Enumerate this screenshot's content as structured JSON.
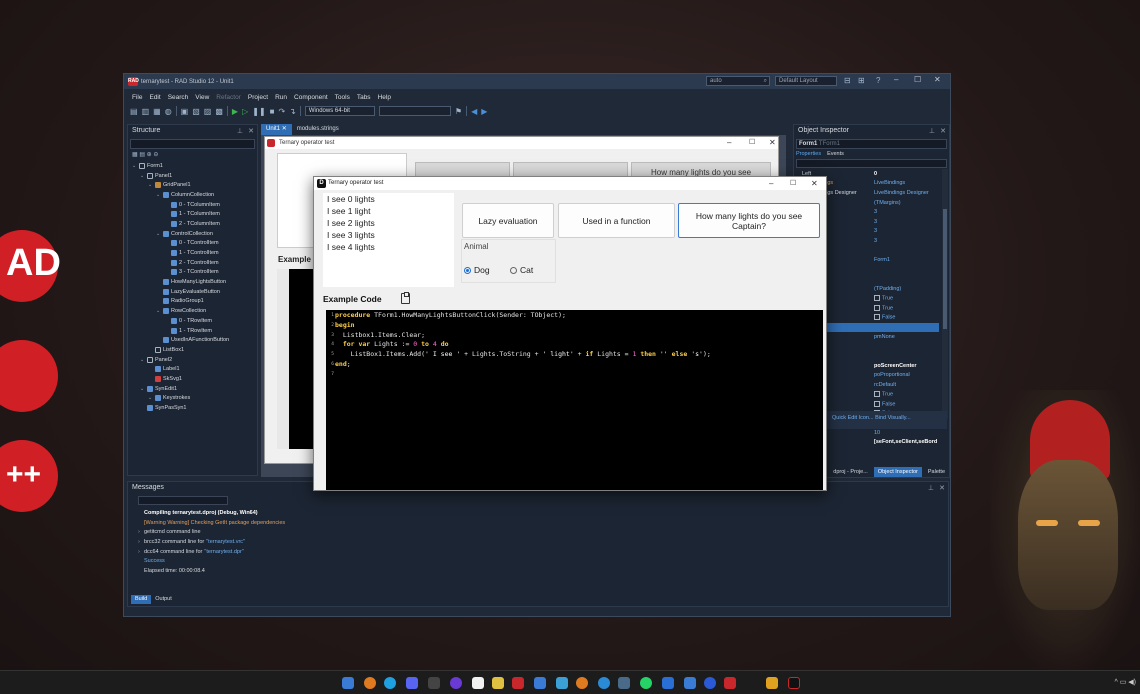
{
  "ide": {
    "title": "ternarytest - RAD Studio 12 - Unit1",
    "search_value": "auto",
    "layout": "Default Layout",
    "menu": [
      "File",
      "Edit",
      "Search",
      "View",
      "Refactor",
      "Project",
      "Run",
      "Component",
      "Tools",
      "Tabs",
      "Help"
    ],
    "platform": "Windows 64-bit"
  },
  "structure": {
    "title": "Structure",
    "tree": [
      {
        "label": "Form1",
        "depth": 0,
        "icon": "form-icon"
      },
      {
        "label": "Panel1",
        "depth": 1,
        "icon": "panel-icon"
      },
      {
        "label": "GridPanel1",
        "depth": 2,
        "icon": "gridpanel-icon"
      },
      {
        "label": "ColumnCollection",
        "depth": 3,
        "icon": "collection-icon"
      },
      {
        "label": "0 - TColumnItem",
        "depth": 4,
        "icon": "item-icon"
      },
      {
        "label": "1 - TColumnItem",
        "depth": 4,
        "icon": "item-icon"
      },
      {
        "label": "2 - TColumnItem",
        "depth": 4,
        "icon": "item-icon"
      },
      {
        "label": "ControlCollection",
        "depth": 3,
        "icon": "collection-icon"
      },
      {
        "label": "0 - TControlItem",
        "depth": 4,
        "icon": "item-icon"
      },
      {
        "label": "1 - TControlItem",
        "depth": 4,
        "icon": "item-icon"
      },
      {
        "label": "2 - TControlItem",
        "depth": 4,
        "icon": "item-icon"
      },
      {
        "label": "3 - TControlItem",
        "depth": 4,
        "icon": "item-icon"
      },
      {
        "label": "HowManyLightsButton",
        "depth": 3,
        "icon": "button-icon"
      },
      {
        "label": "LazyEvaluateButton",
        "depth": 3,
        "icon": "button-icon"
      },
      {
        "label": "RadioGroup1",
        "depth": 3,
        "icon": "radiogroup-icon"
      },
      {
        "label": "RowCollection",
        "depth": 3,
        "icon": "collection-icon"
      },
      {
        "label": "0 - TRowItem",
        "depth": 4,
        "icon": "item-icon"
      },
      {
        "label": "1 - TRowItem",
        "depth": 4,
        "icon": "item-icon"
      },
      {
        "label": "UsedInAFunctionButton",
        "depth": 3,
        "icon": "button-icon"
      },
      {
        "label": "ListBox1",
        "depth": 2,
        "icon": "listbox-icon"
      },
      {
        "label": "Panel2",
        "depth": 1,
        "icon": "panel-icon"
      },
      {
        "label": "Label1",
        "depth": 2,
        "icon": "label-icon"
      },
      {
        "label": "SkSvg1",
        "depth": 2,
        "icon": "svg-icon"
      },
      {
        "label": "SynEdit1",
        "depth": 1,
        "icon": "synedit-icon"
      },
      {
        "label": "Keystrokes",
        "depth": 2,
        "icon": "keystrokes-icon"
      },
      {
        "label": "SynPasSyn1",
        "depth": 1,
        "icon": "synpassyn-icon"
      }
    ]
  },
  "tabs": [
    "Unit1",
    "modules.strings"
  ],
  "designer": {
    "form_title": "Ternary operator test",
    "button_text": "How many lights do you see",
    "example_label": "Example"
  },
  "inspector": {
    "title": "Object Inspector",
    "object": "Form1",
    "object_type": "TForm1",
    "tab_properties": "Properties",
    "tab_events": "Events",
    "rows": [
      {
        "k": "Left",
        "v": "0",
        "style": "w"
      },
      {
        "k": "LiveBindings",
        "v": "LiveBindings",
        "style": "o"
      },
      {
        "k": "LiveBindings Designer",
        "v": "LiveBindings Designer",
        "style": ""
      },
      {
        "k": "",
        "v": "(TMargins)",
        "style": ""
      },
      {
        "k": "m",
        "v": "3",
        "style": ""
      },
      {
        "k": "",
        "v": "3",
        "style": ""
      },
      {
        "k": "",
        "v": "3",
        "style": ""
      },
      {
        "k": "",
        "v": "3",
        "style": ""
      },
      {
        "k": "",
        "v": "",
        "style": ""
      },
      {
        "k": "",
        "v": "Form1",
        "style": ""
      },
      {
        "k": "",
        "v": "",
        "style": ""
      },
      {
        "k": "enuItem",
        "v": "",
        "style": "o"
      },
      {
        "k": "",
        "v": "(TPadding)",
        "style": ""
      },
      {
        "k": "DiMode",
        "v": "True",
        "style": "chk"
      },
      {
        "k": "ustomHint",
        "v": "True",
        "style": "chk"
      },
      {
        "k": "nt",
        "v": "False",
        "style": "chk"
      },
      {
        "k": "enu",
        "v": "",
        "style": "sel"
      },
      {
        "k": "ode",
        "v": "pmNone",
        "style": ""
      },
      {
        "k": "rent",
        "v": "",
        "style": "o"
      },
      {
        "k": "",
        "v": "",
        "style": ""
      },
      {
        "k": "",
        "v": "poScreenCenter",
        "style": "w"
      },
      {
        "k": "e",
        "v": "poProportional",
        "style": ""
      },
      {
        "k": "lCorners",
        "v": "rcDefault",
        "style": ""
      },
      {
        "k": "",
        "v": "True",
        "style": "chk"
      },
      {
        "k": "ap",
        "v": "False",
        "style": "chk"
      },
      {
        "k": "t",
        "v": "False",
        "style": "chk"
      },
      {
        "k": "skBar",
        "v": "False",
        "style": "chk"
      },
      {
        "k": "er",
        "v": "10",
        "style": ""
      },
      {
        "k": "ements",
        "v": "[seFont,seClient,seBord",
        "style": "w"
      },
      {
        "k": "ne",
        "v": "",
        "style": ""
      }
    ],
    "links": "Quick Edit Icon...  Bind Visually...",
    "bottom_tabs": [
      "dproj - Proje...",
      "Object Inspector",
      "Palette"
    ]
  },
  "messages": {
    "title": "Messages",
    "lines": [
      {
        "t": "Compiling ternarytest.dproj (Debug, Win64)",
        "style": "bold",
        "caret": false
      },
      {
        "t": "[Warning Warning] Checking GetIt package dependencies",
        "style": "warn",
        "caret": false
      },
      {
        "t": "getitcmd command line",
        "style": "",
        "caret": true
      },
      {
        "t": "brcc32 command line for ",
        "blue": "\"ternarytest.vrc\"",
        "style": "",
        "caret": true
      },
      {
        "t": "dcc64 command line for ",
        "blue": "\"ternarytest.dpr\"",
        "style": "",
        "caret": true
      },
      {
        "t": "Success",
        "style": "success",
        "caret": false
      },
      {
        "t": "Elapsed time: 00:00:08.4",
        "style": "",
        "caret": false
      }
    ],
    "tabs": [
      "Build",
      "Output"
    ]
  },
  "app": {
    "title": "Ternary operator test",
    "list": [
      "I see 0 lights",
      "I see 1 light",
      "I see 2 lights",
      "I see 3 lights",
      "I see 4 lights"
    ],
    "btn_lazy": "Lazy evaluation",
    "btn_func": "Used in a function",
    "btn_lights": "How many lights do you see Captain?",
    "radio_caption": "Animal",
    "radio_dog": "Dog",
    "radio_cat": "Cat",
    "example_label": "Example Code"
  },
  "colors": {
    "accent": "#2f6db5",
    "brand": "#c8282c"
  }
}
